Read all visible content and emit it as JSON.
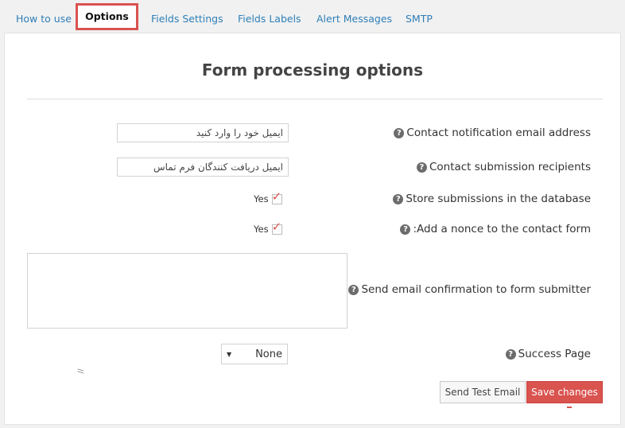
{
  "tabs": [
    {
      "label": "How to use"
    },
    {
      "label": "Options"
    },
    {
      "label": "Fields Settings"
    },
    {
      "label": "Fields Labels"
    },
    {
      "label": "Alert Messages"
    },
    {
      "label": "SMTP"
    }
  ],
  "active_tab": "Options",
  "page_title": "Form processing options",
  "help_glyph": "?",
  "fields": {
    "notification_email": {
      "label": "Contact notification email address",
      "value": "ایمیل خود را وارد کنید"
    },
    "recipients": {
      "label": "Contact submission recipients",
      "value": "ایمیل دریافت کنندگان فرم تماس"
    },
    "store_submissions": {
      "label": "Store submissions in the database",
      "checkbox_label": "Yes",
      "checked": true
    },
    "nonce": {
      "label": ":Add a nonce to the contact form",
      "checkbox_label": "Yes",
      "checked": true
    },
    "confirmation": {
      "label": "Send email confirmation to form submitter",
      "value": ""
    },
    "success_page": {
      "label": "Success Page",
      "selected": "None"
    }
  },
  "buttons": {
    "test_email": "Send Test Email",
    "save": "Save changes"
  },
  "colors": {
    "accent": "#d9534f",
    "link": "#2e7fb8"
  },
  "icons": {
    "help": "help-circle-icon",
    "check": "checkmark-icon",
    "select": "caret-down-icon",
    "resize": "resize-grip-icon"
  }
}
